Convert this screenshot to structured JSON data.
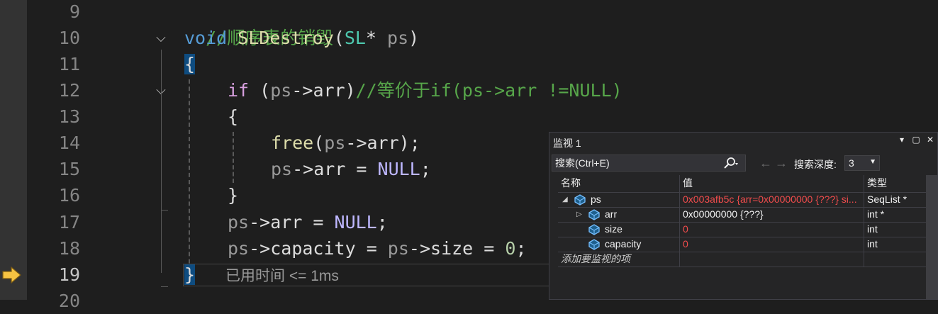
{
  "editor": {
    "lines": [
      {
        "num": "9"
      },
      {
        "num": "10"
      },
      {
        "num": "11"
      },
      {
        "num": "12"
      },
      {
        "num": "13"
      },
      {
        "num": "14"
      },
      {
        "num": "15"
      },
      {
        "num": "16"
      },
      {
        "num": "17"
      },
      {
        "num": "18"
      },
      {
        "num": "19"
      },
      {
        "num": "20"
      }
    ],
    "code": {
      "l9_comment": "//顺序表的销毁",
      "l10_void": "void",
      "l10_fn": "SLDestroy",
      "l10_open": "(",
      "l10_type": "SL",
      "l10_star": "*",
      "l10_param": " ps",
      "l10_close": ")",
      "l11_brace": "{",
      "l12_if": "if",
      "l12_open": " (",
      "l12_ps": "ps",
      "l12_arrow": "->",
      "l12_arr": "arr",
      "l12_close": ")",
      "l12_comment": "//等价于if(ps->arr !=NULL)",
      "l13_brace": "{",
      "l14_free": "free",
      "l14_open": "(",
      "l14_ps": "ps",
      "l14_arrow": "->",
      "l14_arr": "arr",
      "l14_close": ");",
      "l15_ps": "ps",
      "l15_arrow": "->",
      "l15_arr": "arr",
      "l15_eq": " = ",
      "l15_null": "NULL",
      "l15_semi": ";",
      "l16_brace": "}",
      "l17_ps": "ps",
      "l17_arrow": "->",
      "l17_arr": "arr",
      "l17_eq": " = ",
      "l17_null": "NULL",
      "l17_semi": ";",
      "l18_ps": "ps",
      "l18_arrow": "->",
      "l18_cap": "capacity",
      "l18_eq": " = ",
      "l18_ps2": "ps",
      "l18_arrow2": "->",
      "l18_size": "size",
      "l18_eq2": " = ",
      "l18_zero": "0",
      "l18_semi": ";",
      "l19_brace": "}"
    },
    "elapsed": "已用时间 <= 1ms",
    "fold_glyph": "⌵"
  },
  "watch": {
    "title": "监视 1",
    "search_placeholder": "搜索(Ctrl+E)",
    "depth_label": "搜索深度:",
    "depth_value": "3",
    "columns": {
      "name": "名称",
      "value": "值",
      "type": "类型"
    },
    "rows": [
      {
        "name": "ps",
        "value": "0x003afb5c {arr=0x00000000 {???} si...",
        "type": "SeqList *",
        "expander": "◢",
        "value_color": "red"
      },
      {
        "name": "arr",
        "value": "0x00000000 {???}",
        "type": "int *",
        "expander": "▷",
        "value_color": "white"
      },
      {
        "name": "size",
        "value": "0",
        "type": "int",
        "expander": "",
        "value_color": "red"
      },
      {
        "name": "capacity",
        "value": "0",
        "type": "int",
        "expander": "",
        "value_color": "red"
      }
    ],
    "add_item": "添加要监视的项"
  }
}
